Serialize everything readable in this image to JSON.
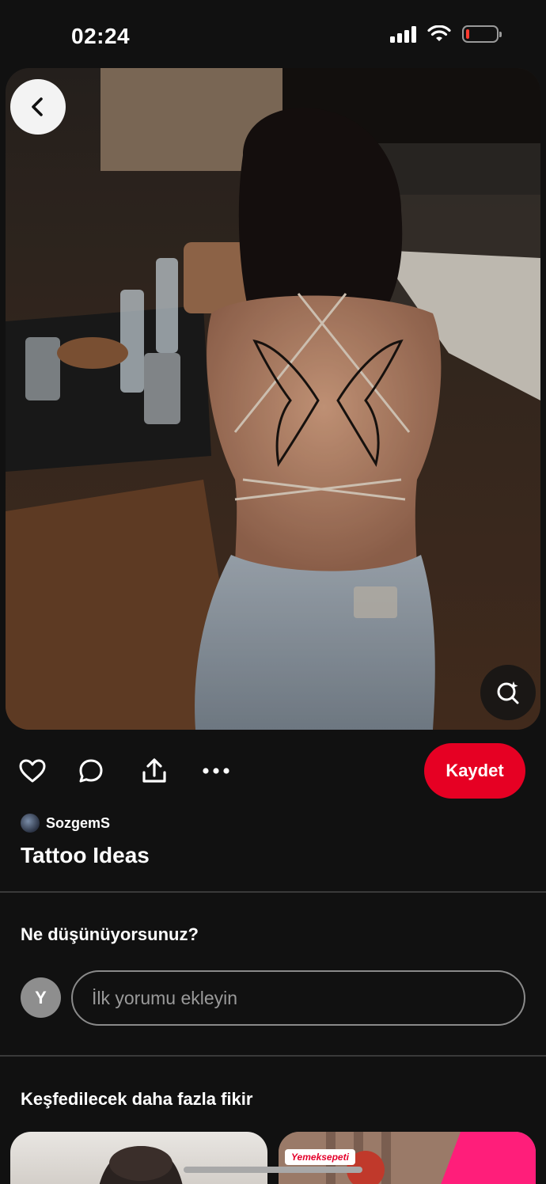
{
  "status_bar": {
    "time": "02:24",
    "icons": [
      "cellular-signal-icon",
      "wifi-icon",
      "battery-low-icon"
    ]
  },
  "pin": {
    "image_icon_names": [
      "back-arrow-icon",
      "visual-search-icon"
    ],
    "actions": [
      "heart-icon",
      "comment-icon",
      "share-icon",
      "more-options-icon"
    ],
    "save_label": "Kaydet",
    "author": "SozgemS",
    "title": "Tattoo Ideas"
  },
  "comments": {
    "heading": "Ne düşünüyorsunuz?",
    "user_initial": "Y",
    "placeholder": "İlk yorumu ekleyin"
  },
  "more_ideas": {
    "heading": "Keşfedilecek daha fazla fikir",
    "thumb_2_badge": "Yemeksepeti"
  },
  "colors": {
    "background": "#111111",
    "accent": "#e60023",
    "text": "#ffffff",
    "divider": "#3a3a3a"
  }
}
